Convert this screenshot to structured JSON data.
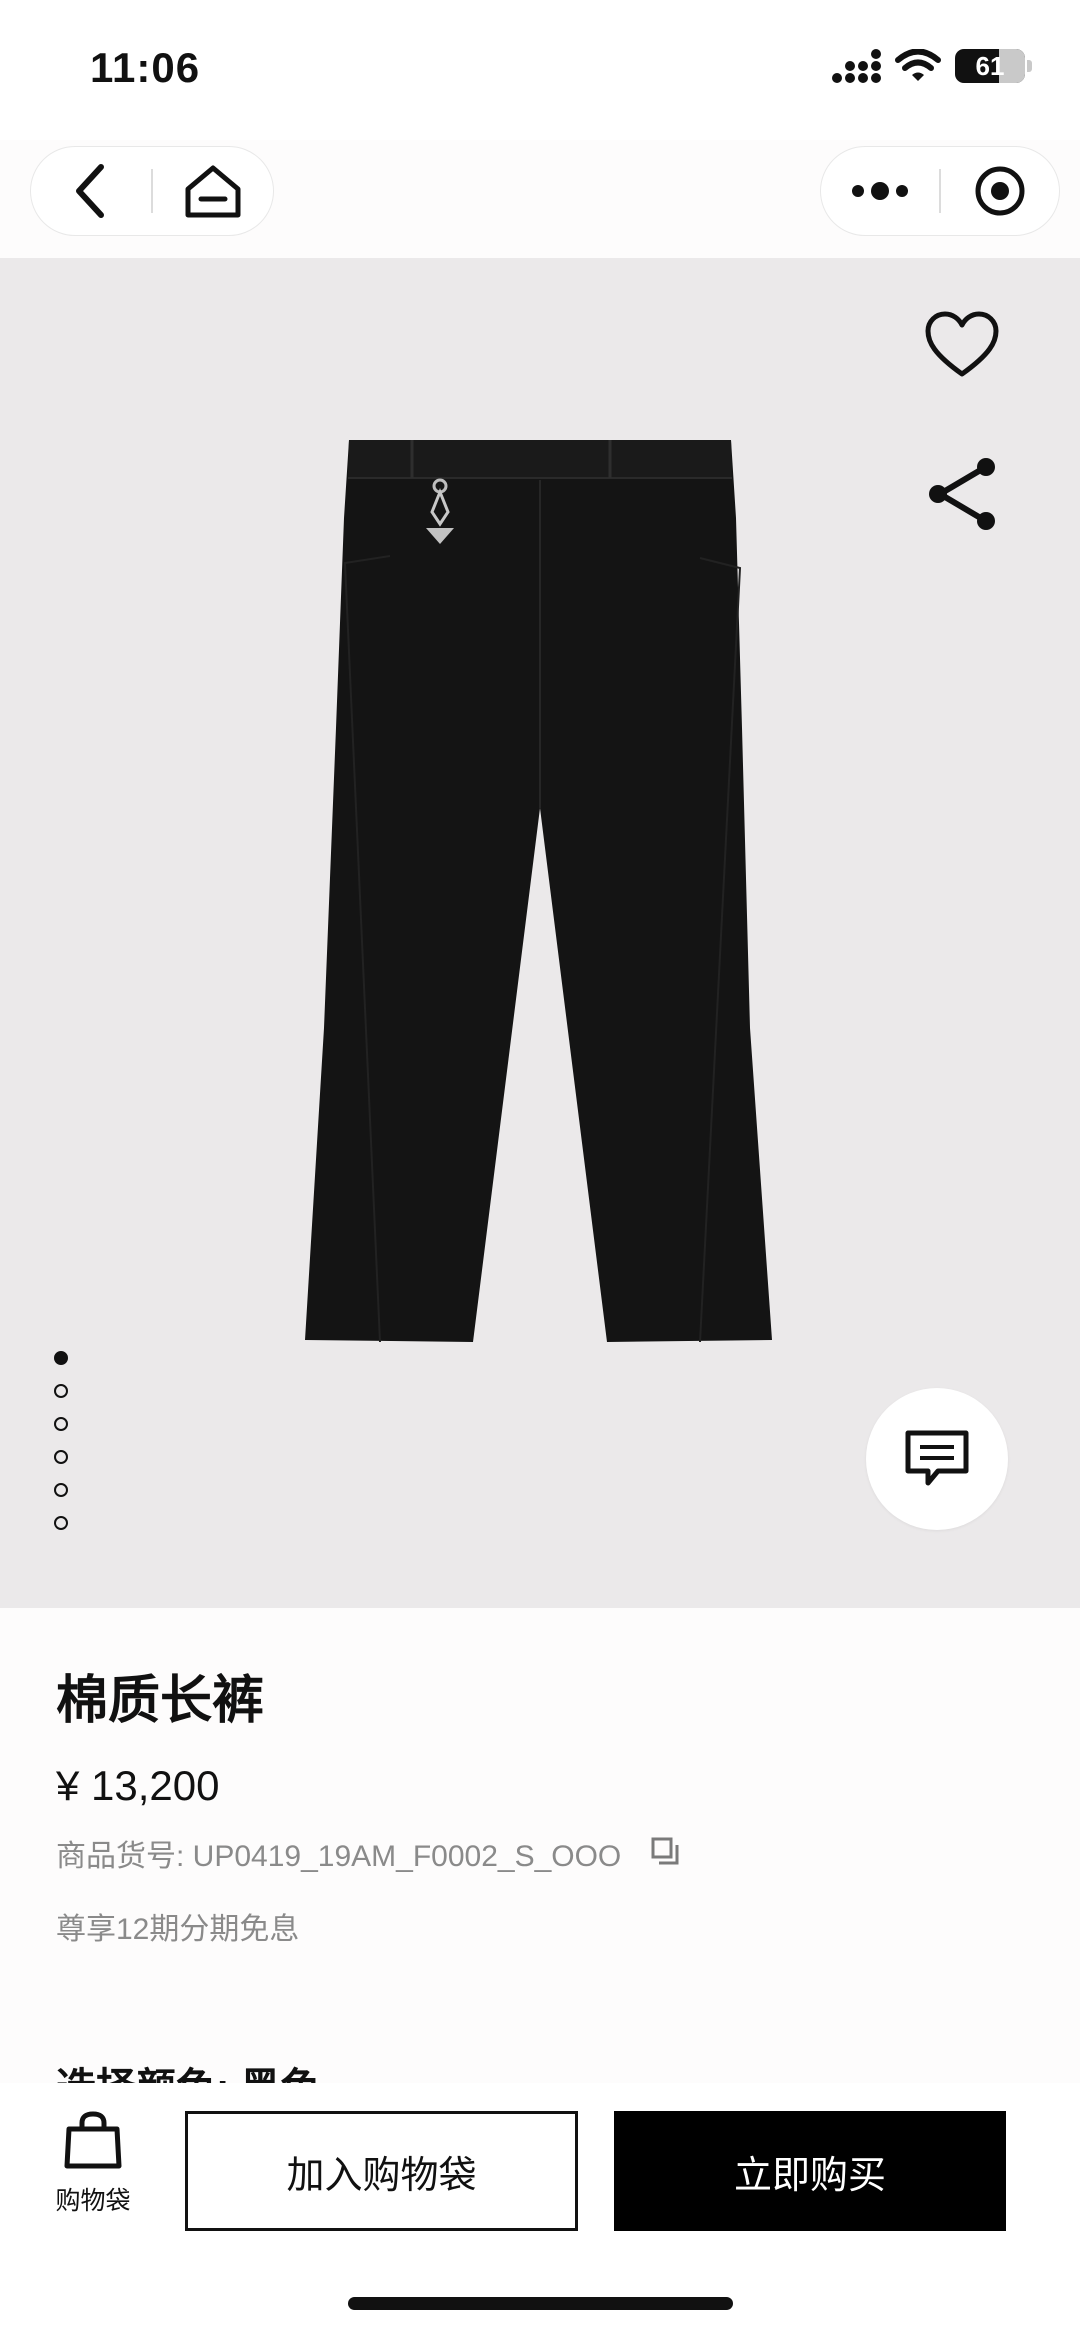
{
  "status_bar": {
    "time": "11:06",
    "battery": "61"
  },
  "hero": {
    "image_count": 6,
    "active_index": 0
  },
  "product": {
    "title": "棉质长裤",
    "price": "¥ 13,200",
    "sku": "商品货号: UP0419_19AM_F0002_S_OOO",
    "installment": "尊享12期分期免息",
    "color_label": "选择颜色: 黑色"
  },
  "bottom_bar": {
    "bag_label": "购物袋",
    "add_to_bag": "加入购物袋",
    "buy_now": "立即购买"
  },
  "icons": [
    "back-icon",
    "home-icon",
    "more-icon",
    "target-icon",
    "heart-icon",
    "share-icon",
    "chat-icon",
    "copy-icon",
    "bag-icon"
  ],
  "colors": {
    "hero_background": "#ebe9ea",
    "primary": "#000000",
    "secondary_text": "#8a8a8a"
  }
}
